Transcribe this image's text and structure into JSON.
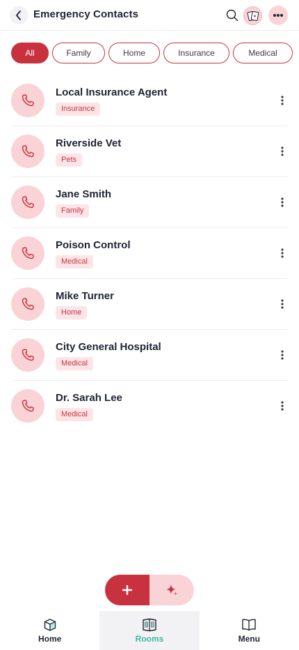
{
  "header": {
    "title": "Emergency Contacts",
    "back_icon": "chevron-left-icon",
    "search_icon": "search-icon",
    "avatar_icon": "avatar-card-icon",
    "more_icon": "more-horizontal-icon"
  },
  "filters": [
    {
      "label": "All",
      "active": true
    },
    {
      "label": "Family",
      "active": false
    },
    {
      "label": "Home",
      "active": false
    },
    {
      "label": "Insurance",
      "active": false
    },
    {
      "label": "Medical",
      "active": false
    }
  ],
  "contacts": [
    {
      "name": "Local Insurance Agent",
      "tag": "Insurance"
    },
    {
      "name": "Riverside Vet",
      "tag": "Pets"
    },
    {
      "name": "Jane Smith",
      "tag": "Family"
    },
    {
      "name": "Poison Control",
      "tag": "Medical"
    },
    {
      "name": "Mike Turner",
      "tag": "Home"
    },
    {
      "name": "City General Hospital",
      "tag": "Medical"
    },
    {
      "name": "Dr. Sarah Lee",
      "tag": "Medical"
    }
  ],
  "fab": {
    "add_icon": "plus-icon",
    "ai_icon": "sparkle-icon"
  },
  "nav": [
    {
      "label": "Home",
      "icon": "cube-icon",
      "active": false
    },
    {
      "label": "Rooms",
      "icon": "rooms-icon",
      "active": true
    },
    {
      "label": "Menu",
      "icon": "book-icon",
      "active": false
    }
  ],
  "colors": {
    "accent": "#c8323f",
    "accent_soft": "#f9d3d6",
    "tag_bg": "#fde5e7",
    "nav_active": "#3cb9a2",
    "text": "#1f2333"
  }
}
